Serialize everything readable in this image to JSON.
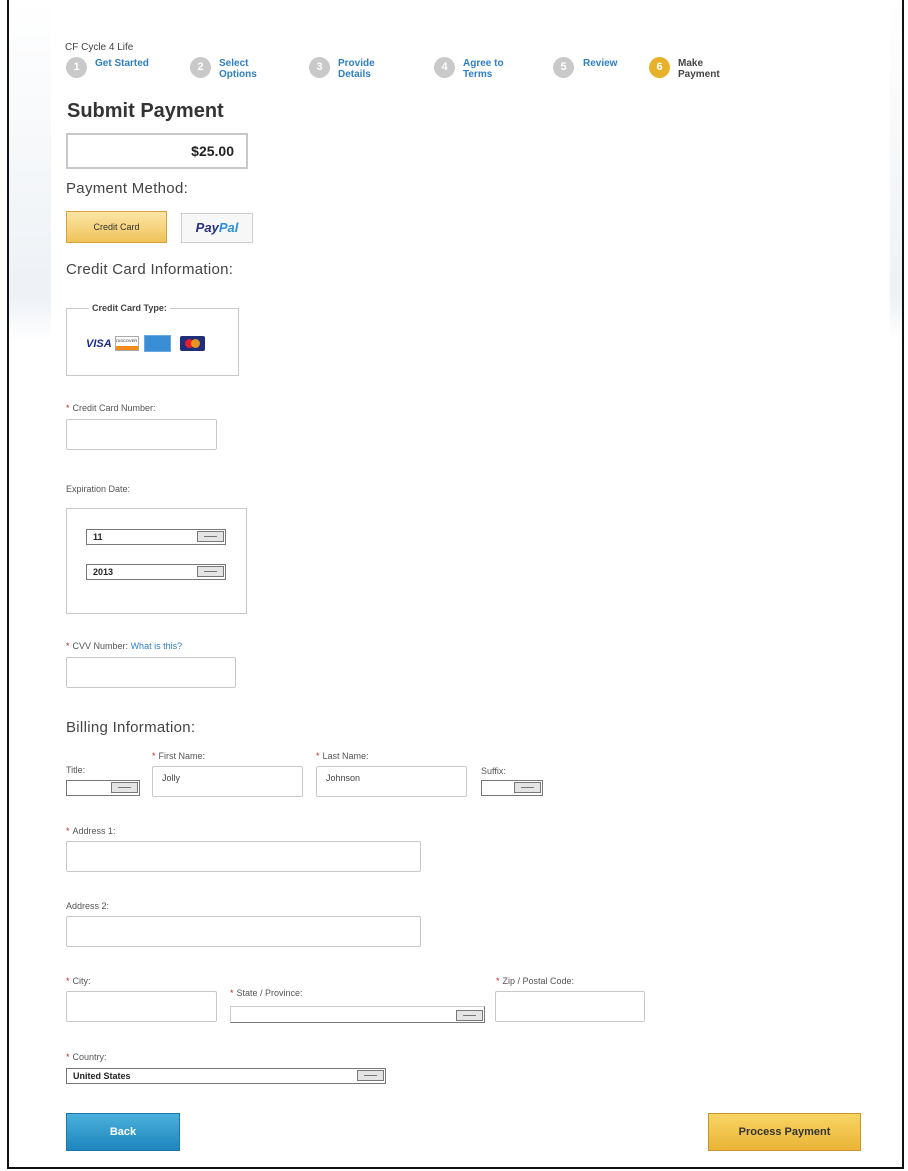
{
  "org_name": "CF Cycle 4 Life",
  "steps": [
    {
      "num": "1",
      "label": "Get Started",
      "active": false
    },
    {
      "num": "2",
      "label": "Select Options",
      "active": false
    },
    {
      "num": "3",
      "label": "Provide Details",
      "active": false
    },
    {
      "num": "4",
      "label": "Agree to Terms",
      "active": false
    },
    {
      "num": "5",
      "label": "Review",
      "active": false
    },
    {
      "num": "6",
      "label": "Make Payment",
      "active": true
    }
  ],
  "page_title": "Submit Payment",
  "amount": "$25.00",
  "payment_method": {
    "heading": "Payment Method:",
    "credit_card_label": "Credit Card",
    "paypal_label_a": "Pay",
    "paypal_label_b": "Pal"
  },
  "credit_card": {
    "heading": "Credit Card Information:",
    "type_legend": "Credit Card Type:",
    "card_logos": {
      "visa": "VISA",
      "discover": "DISCOVER",
      "amex": "amex-logo",
      "mastercard": "mastercard-logo"
    },
    "number_label": "Credit Card Number:",
    "number_value": "",
    "expiration_label": "Expiration Date:",
    "exp_month": "11",
    "exp_year": "2013",
    "cvv_label": "CVV Number:",
    "cvv_help_link": "What is this?",
    "cvv_value": ""
  },
  "billing": {
    "heading": "Billing Information:",
    "title_label": "Title:",
    "title_value": "",
    "first_name_label": "First Name:",
    "first_name_value": "Jolly",
    "last_name_label": "Last Name:",
    "last_name_value": "Johnson",
    "suffix_label": "Suffix:",
    "suffix_value": "",
    "address1_label": "Address 1:",
    "address1_value": "",
    "address2_label": "Address 2:",
    "address2_value": "",
    "city_label": "City:",
    "city_value": "",
    "state_label": "State / Province:",
    "state_value": "",
    "zip_label": "Zip / Postal Code:",
    "zip_value": "",
    "country_label": "Country:",
    "country_value": "United States"
  },
  "buttons": {
    "back": "Back",
    "process": "Process Payment"
  },
  "required_marker": "*",
  "colors": {
    "accent_blue": "#2e7fc4",
    "active_step": "#e8b12a",
    "required": "#c0282d"
  }
}
